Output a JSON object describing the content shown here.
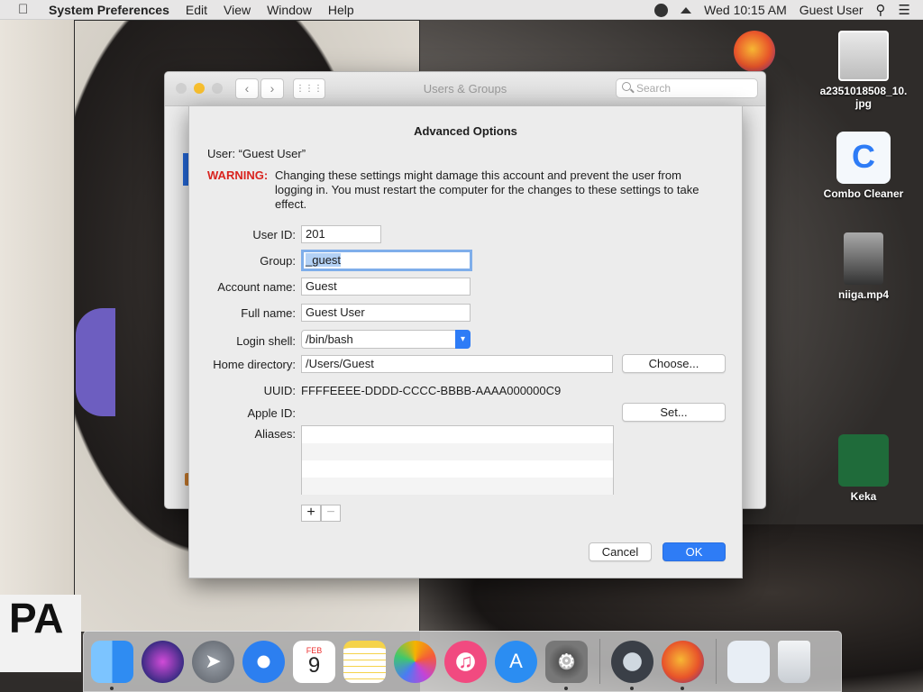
{
  "menubar": {
    "app_name": "System Preferences",
    "menus": [
      "Edit",
      "View",
      "Window",
      "Help"
    ],
    "clock": "Wed 10:15 AM",
    "user": "Guest User"
  },
  "desktop_icons": [
    {
      "label": "a2351018508_10.\njpg",
      "icon": "image-file-icon"
    },
    {
      "label": "Combo Cleaner",
      "icon": "combo-cleaner-icon"
    },
    {
      "label": "niiga.mp4",
      "icon": "video-file-icon"
    },
    {
      "label": "Keka",
      "icon": "keka-icon"
    }
  ],
  "window": {
    "title": "Users & Groups",
    "search_placeholder": "Search"
  },
  "sheet": {
    "title": "Advanced Options",
    "user_line": "User:  “Guest User”",
    "warning_label": "WARNING:",
    "warning_text": "Changing these settings might damage this account and prevent the user from logging in. You must restart the computer for the changes to these settings to take effect.",
    "fields": {
      "user_id": {
        "label": "User ID:",
        "value": "201"
      },
      "group": {
        "label": "Group:",
        "value": "_guest"
      },
      "account_name": {
        "label": "Account name:",
        "value": "Guest"
      },
      "full_name": {
        "label": "Full name:",
        "value": "Guest User"
      },
      "login_shell": {
        "label": "Login shell:",
        "value": "/bin/bash"
      },
      "home_directory": {
        "label": "Home directory:",
        "value": "/Users/Guest"
      },
      "uuid": {
        "label": "UUID:",
        "value": "FFFFEEEE-DDDD-CCCC-BBBB-AAAA000000C9"
      },
      "apple_id": {
        "label": "Apple ID:",
        "value": ""
      },
      "aliases": {
        "label": "Aliases:"
      }
    },
    "buttons": {
      "choose": "Choose...",
      "set": "Set...",
      "add": "+",
      "remove": "−",
      "cancel": "Cancel",
      "ok": "OK"
    }
  },
  "dock": [
    {
      "name": "Finder",
      "color": "#2f8cf2"
    },
    {
      "name": "Siri",
      "color": "#3b2b84"
    },
    {
      "name": "Launchpad",
      "color": "#7a7f87"
    },
    {
      "name": "Safari",
      "color": "#2c7ff0"
    },
    {
      "name": "Calendar",
      "color": "#ffffff",
      "month": "FEB",
      "day": "9"
    },
    {
      "name": "Notes",
      "color": "#f5d34a"
    },
    {
      "name": "Photos",
      "color": "#ffffff"
    },
    {
      "name": "iTunes",
      "color": "#f14a80"
    },
    {
      "name": "App Store",
      "color": "#2b8df2"
    },
    {
      "name": "System Preferences",
      "color": "#6e6e6e"
    },
    {
      "name": "QuickTime Player",
      "color": "#3a3f47"
    },
    {
      "name": "Firefox",
      "color": "#f16a1f"
    },
    {
      "name": "Downloads",
      "color": "#e8eef5"
    },
    {
      "name": "Trash",
      "color": "#d9dde2"
    }
  ]
}
